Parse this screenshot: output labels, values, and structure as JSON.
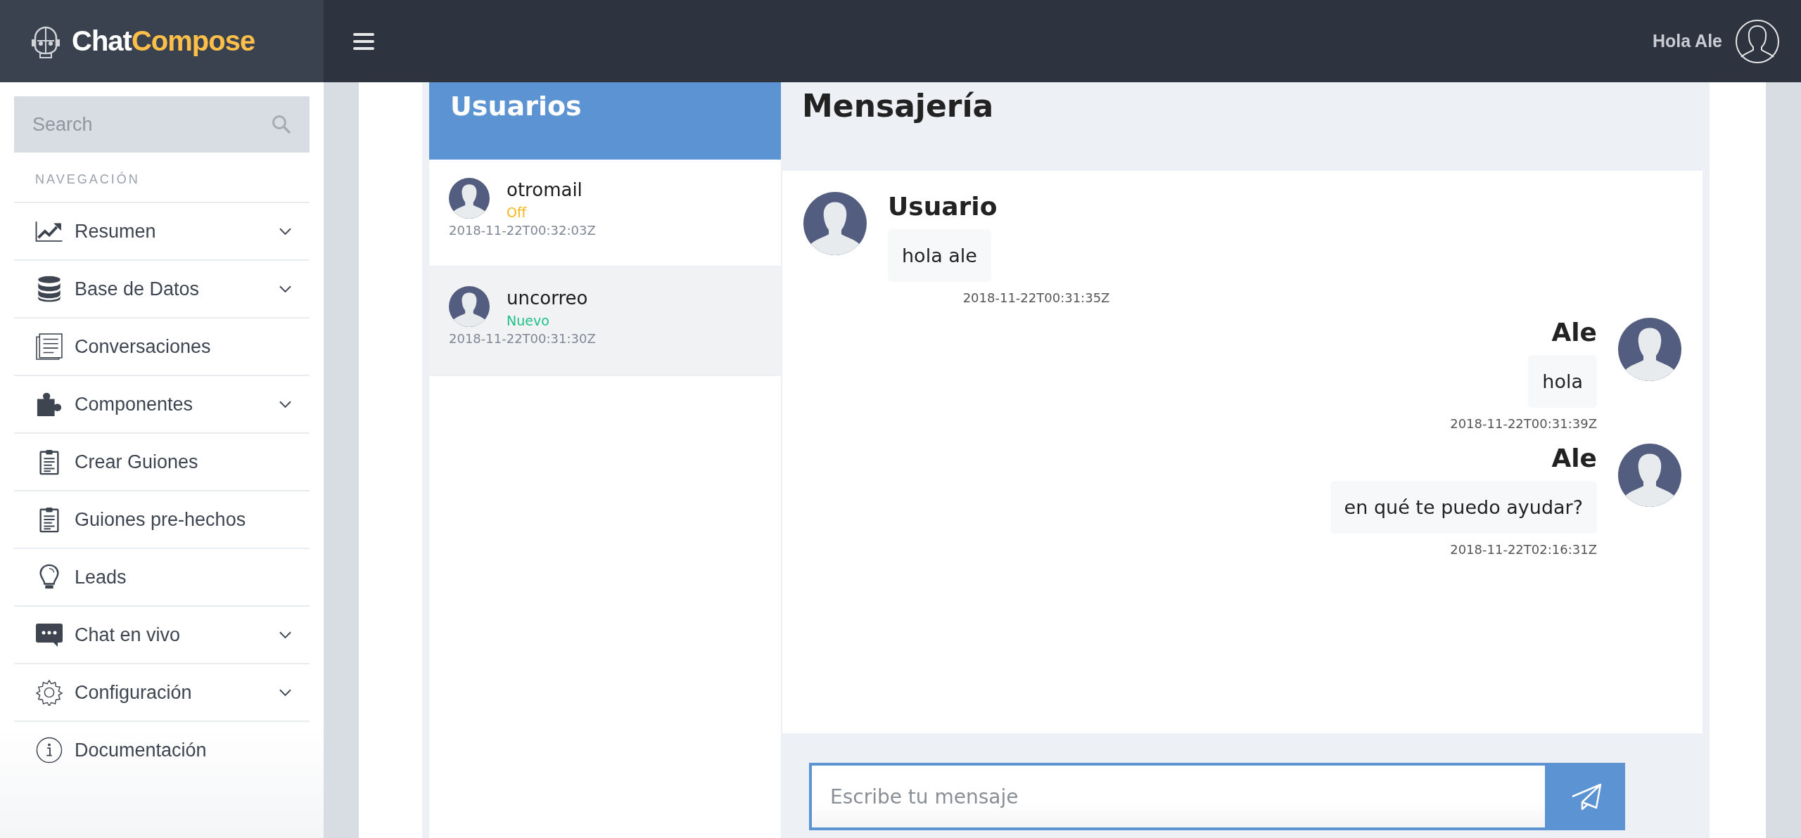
{
  "brand": {
    "first": "Chat",
    "second": "Compose"
  },
  "header": {
    "greeting": "Hola Ale"
  },
  "sidebar": {
    "search": {
      "placeholder": "Search"
    },
    "section": "NAVEGACIÓN",
    "items": [
      {
        "label": "Resumen",
        "kind": "chart",
        "expandable": true
      },
      {
        "label": "Base de Datos",
        "kind": "database",
        "expandable": true
      },
      {
        "label": "Conversaciones",
        "kind": "document",
        "expandable": false
      },
      {
        "label": "Componentes",
        "kind": "puzzle",
        "expandable": true
      },
      {
        "label": "Crear Guiones",
        "kind": "clipboard",
        "expandable": false
      },
      {
        "label": "Guiones pre-hechos",
        "kind": "clipboard",
        "expandable": false
      },
      {
        "label": "Leads",
        "kind": "bulb",
        "expandable": false
      },
      {
        "label": "Chat en vivo",
        "kind": "chat",
        "expandable": true
      },
      {
        "label": "Configuración",
        "kind": "gear",
        "expandable": true
      },
      {
        "label": "Documentación",
        "kind": "info",
        "expandable": false
      }
    ]
  },
  "users": {
    "title": "Usuarios",
    "items": [
      {
        "name": "otromail",
        "status": "Off",
        "color": "#f5b716",
        "time": "2018-11-22T00:32:03Z",
        "selected": false
      },
      {
        "name": "uncorreo",
        "status": "Nuevo",
        "color": "#1dbf86",
        "time": "2018-11-22T00:31:30Z",
        "selected": true
      }
    ]
  },
  "chat": {
    "title": "Mensajería",
    "messages": [
      {
        "kind": "incoming",
        "sender": "Usuario",
        "text": "hola ale",
        "time": "2018-11-22T00:31:35Z"
      },
      {
        "kind": "outgoing",
        "sender": "Ale",
        "text": "hola",
        "time": "2018-11-22T00:31:39Z"
      },
      {
        "kind": "outgoing",
        "sender": "Ale",
        "text": "en qué te puedo ayudar?",
        "time": "2018-11-22T02:16:31Z"
      }
    ],
    "input": {
      "placeholder": "Escribe tu mensaje"
    }
  }
}
